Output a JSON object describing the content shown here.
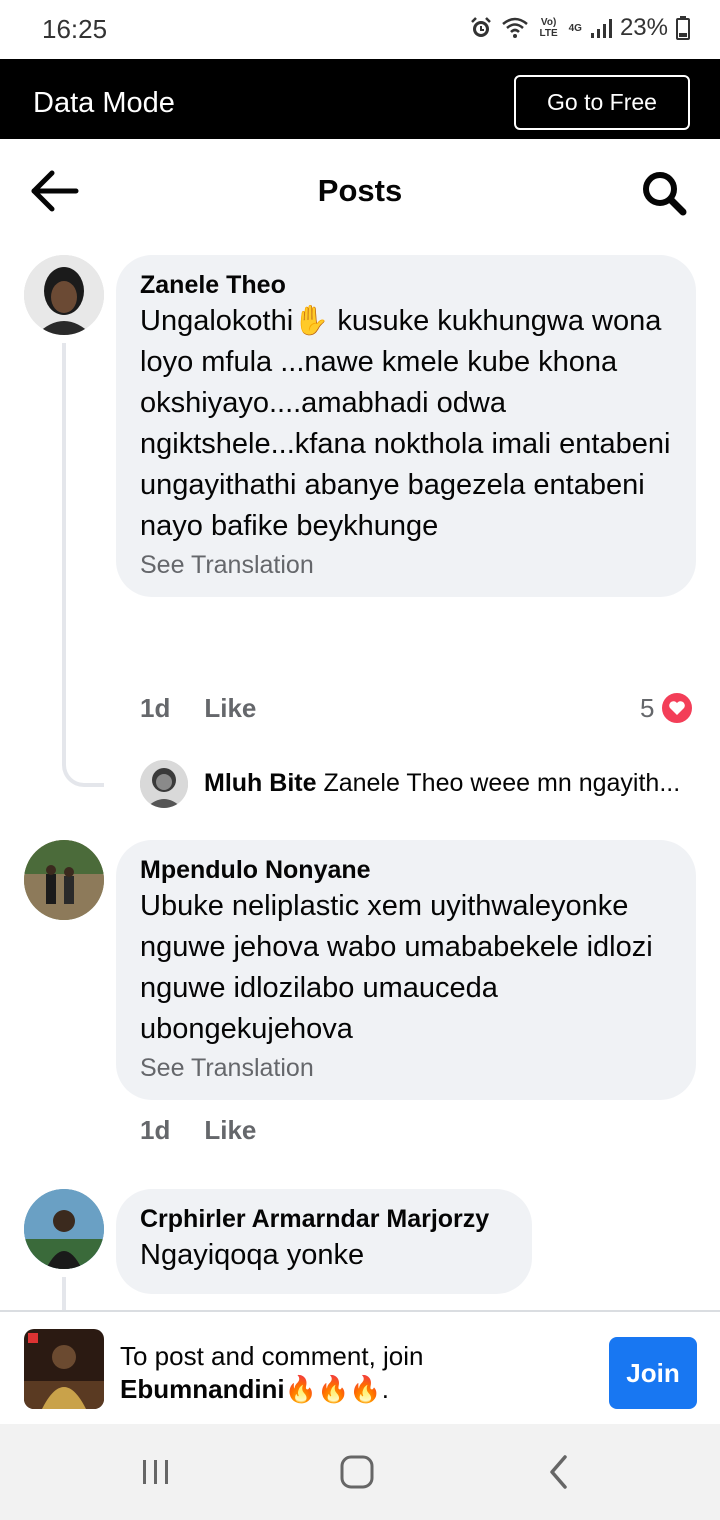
{
  "status": {
    "time": "16:25",
    "volte": "Vo) LTE",
    "network": "4G",
    "battery": "23%"
  },
  "data_bar": {
    "title": "Data Mode",
    "button": "Go to Free"
  },
  "header": {
    "title": "Posts"
  },
  "comments": [
    {
      "author": "Zanele Theo",
      "text": "Ungalokothi✋ kusuke kukhungwa wona loyo mfula ...nawe kmele kube khona okshiyayo....amabhadi odwa ngiktshele...kfana nokthola imali entabeni ungayithathi abanye bagezela entabeni nayo bafike beykhunge",
      "see_translation": "See Translation",
      "time": "1d",
      "like": "Like",
      "reactions": "5",
      "reply": {
        "author": "Mluh Bite",
        "text": "Zanele Theo weee mn ngayith..."
      }
    },
    {
      "author": "Mpendulo Nonyane",
      "text": "Ubuke neliplastic xem uyithwaleyonke nguwe jehova wabo umababekele idlozi nguwe idlozilabo umauceda ubongekujehova",
      "see_translation": "See Translation",
      "time": "1d",
      "like": "Like"
    },
    {
      "author": "Crphirler Armarndar Marjorzy",
      "text": "Ngayiqoqa yonke"
    }
  ],
  "join": {
    "line1": "To post and comment, join",
    "group": "Ebumnandini🔥🔥🔥",
    "suffix": ".",
    "button": "Join"
  },
  "colors": {
    "accent": "#1877f2",
    "bubble": "#f0f2f5",
    "secondary_text": "#65676b",
    "heart": "#f33e58"
  }
}
